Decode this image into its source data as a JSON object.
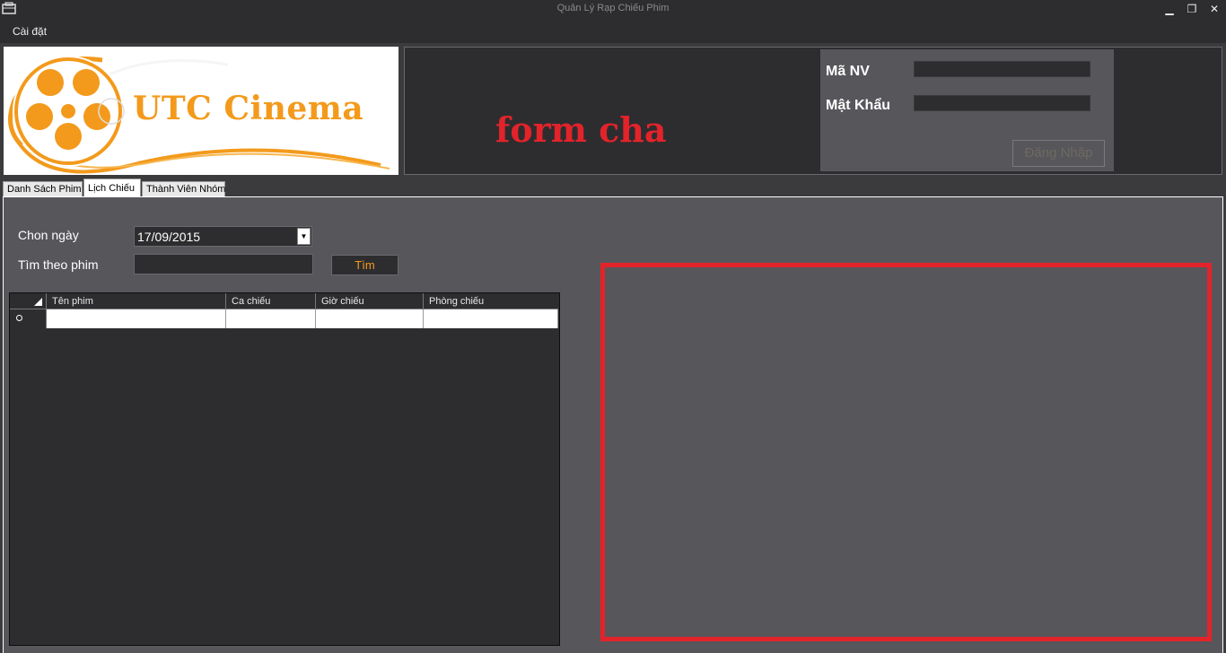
{
  "window": {
    "title": "Quản Lý Rạp Chiếu Phim",
    "minimize": "▁",
    "maximize": "❐",
    "close": "✕"
  },
  "menu": {
    "settings": "Cài đặt"
  },
  "header": {
    "logo_text": "UTC Cinema",
    "form_label": "form cha",
    "login": {
      "employee_id_label": "Mã NV",
      "employee_id_value": "",
      "password_label": "Mật Khẩu",
      "password_value": "",
      "login_button": "Đăng Nhập"
    }
  },
  "tabs": [
    {
      "label": "Danh Sách Phim",
      "active": false
    },
    {
      "label": "Lịch Chiếu",
      "active": true
    },
    {
      "label": "Thành Viên Nhóm",
      "active": false
    }
  ],
  "schedule": {
    "date_label": "Chon ngày",
    "date_value": "17/09/2015",
    "search_label": "Tìm theo phim",
    "search_value": "",
    "search_button": "Tìm",
    "columns": [
      "Tên phim",
      "Ca chiếu",
      "Giờ chiếu",
      "Phòng chiếu"
    ],
    "rows": [
      [
        "",
        "",
        "",
        ""
      ]
    ]
  },
  "colors": {
    "accent_orange": "#f39a1c",
    "accent_red": "#e3232a",
    "panel_dark": "#2d2d30",
    "panel_mid": "#57565b"
  }
}
